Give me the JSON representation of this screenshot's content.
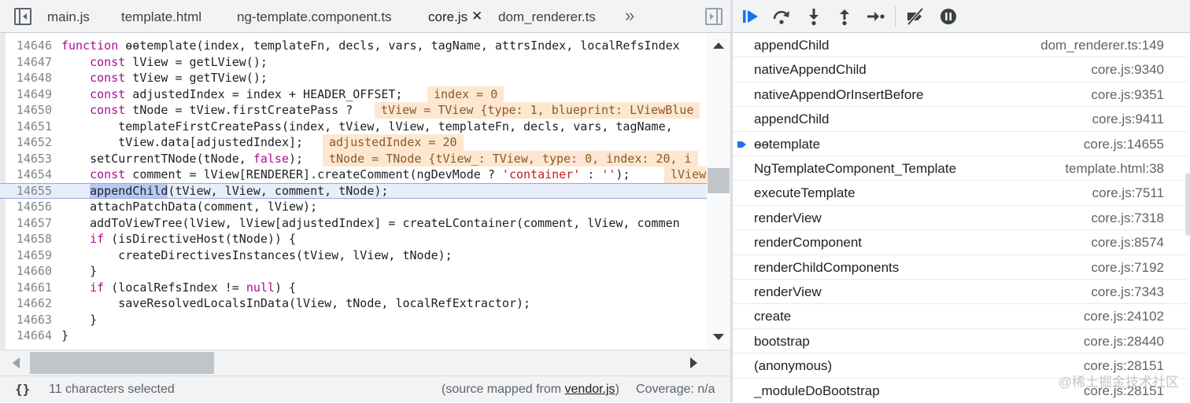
{
  "tabs": [
    {
      "label": "main.js",
      "active": false
    },
    {
      "label": "template.html",
      "active": false
    },
    {
      "label": "ng-template.component.ts",
      "active": false
    },
    {
      "label": "core.js",
      "active": true
    },
    {
      "label": "dom_renderer.ts",
      "active": false
    }
  ],
  "tab_close_glyph": "✕",
  "tab_more_glyph": "»",
  "code_lines": [
    {
      "n": "14646",
      "text": "function ɵɵtemplate(index, templateFn, decls, vars, tagName, attrsIndex, localRefsIndex"
    },
    {
      "n": "14647",
      "text": "    const lView = getLView();"
    },
    {
      "n": "14648",
      "text": "    const tView = getTView();"
    },
    {
      "n": "14649",
      "text": "    const adjustedIndex = index + HEADER_OFFSET;"
    },
    {
      "n": "14650",
      "text": "    const tNode = tView.firstCreatePass ?"
    },
    {
      "n": "14651",
      "text": "        templateFirstCreatePass(index, tView, lView, templateFn, decls, vars, tagName,"
    },
    {
      "n": "14652",
      "text": "        tView.data[adjustedIndex];"
    },
    {
      "n": "14653",
      "text": "    setCurrentTNode(tNode, false);"
    },
    {
      "n": "14654",
      "text": "    const comment = lView[RENDERER].createComment(ngDevMode ? 'container' : '');"
    },
    {
      "n": "14655",
      "text": "    appendChild(tView, lView, comment, tNode);"
    },
    {
      "n": "14656",
      "text": "    attachPatchData(comment, lView);"
    },
    {
      "n": "14657",
      "text": "    addToViewTree(lView, lView[adjustedIndex] = createLContainer(comment, lView, commen"
    },
    {
      "n": "14658",
      "text": "    if (isDirectiveHost(tNode)) {"
    },
    {
      "n": "14659",
      "text": "        createDirectivesInstances(tView, lView, tNode);"
    },
    {
      "n": "14660",
      "text": "    }"
    },
    {
      "n": "14661",
      "text": "    if (localRefsIndex != null) {"
    },
    {
      "n": "14662",
      "text": "        saveResolvedLocalsInData(lView, tNode, localRefExtractor);"
    },
    {
      "n": "14663",
      "text": "    }"
    },
    {
      "n": "14664",
      "text": "}"
    }
  ],
  "inline_values": [
    {
      "line": 3,
      "text": "index = 0"
    },
    {
      "line": 4,
      "text": "tView = TView {type: 1, blueprint: LViewBlue"
    },
    {
      "line": 6,
      "text": "adjustedIndex = 20"
    },
    {
      "line": 7,
      "text": "tNode = TNode {tView_: TView, type: 0, index: 20, i"
    },
    {
      "line": 8,
      "text": "lView"
    }
  ],
  "status": {
    "format_icon": "{}",
    "selection": "11 characters selected",
    "source_mapped_prefix": "(source mapped from ",
    "source_mapped_link": "vendor.js",
    "source_mapped_suffix": ")",
    "coverage": "Coverage: n/a"
  },
  "call_stack": [
    {
      "name": "appendChild",
      "location": "dom_renderer.ts:149",
      "current": false
    },
    {
      "name": "nativeAppendChild",
      "location": "core.js:9340",
      "current": false
    },
    {
      "name": "nativeAppendOrInsertBefore",
      "location": "core.js:9351",
      "current": false
    },
    {
      "name": "appendChild",
      "location": "core.js:9411",
      "current": false
    },
    {
      "name": "ɵɵtemplate",
      "location": "core.js:14655",
      "current": true
    },
    {
      "name": "NgTemplateComponent_Template",
      "location": "template.html:38",
      "current": false
    },
    {
      "name": "executeTemplate",
      "location": "core.js:7511",
      "current": false
    },
    {
      "name": "renderView",
      "location": "core.js:7318",
      "current": false
    },
    {
      "name": "renderComponent",
      "location": "core.js:8574",
      "current": false
    },
    {
      "name": "renderChildComponents",
      "location": "core.js:7192",
      "current": false
    },
    {
      "name": "renderView",
      "location": "core.js:7343",
      "current": false
    },
    {
      "name": "create",
      "location": "core.js:24102",
      "current": false
    },
    {
      "name": "bootstrap",
      "location": "core.js:28440",
      "current": false
    },
    {
      "name": "(anonymous)",
      "location": "core.js:28151",
      "current": false
    },
    {
      "name": "_moduleDoBootstrap",
      "location": "core.js:28151",
      "current": false
    }
  ],
  "watermark": "@稀土掘金技术社区",
  "colors": {
    "accent": "#1a73e8",
    "inline_bg": "#fde7d0",
    "exec_line": "#e8edfb"
  }
}
